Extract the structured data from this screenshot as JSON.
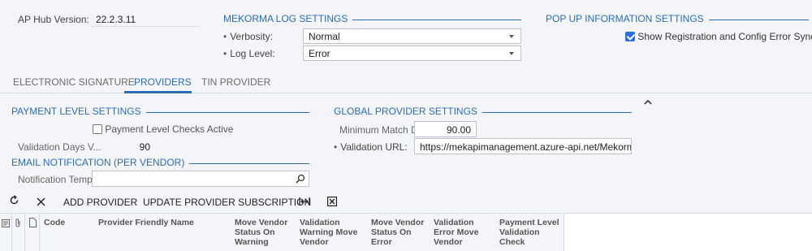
{
  "header": {
    "ap_hub_label": "AP Hub Version:",
    "ap_hub_value": "22.2.3.11"
  },
  "log_settings": {
    "title": "MEKORMA LOG SETTINGS",
    "verbosity_label": "Verbosity:",
    "verbosity_value": "Normal",
    "log_level_label": "Log Level:",
    "log_level_value": "Error"
  },
  "popup_settings": {
    "title": "POP UP INFORMATION SETTINGS",
    "show_errors_label": "Show Registration and Config Error Sync Notes",
    "show_errors_checked": true
  },
  "tabs": [
    {
      "label": "ELECTRONIC SIGNATURE"
    },
    {
      "label": "PROVIDERS"
    },
    {
      "label": "TIN PROVIDER"
    }
  ],
  "payment_level": {
    "title": "PAYMENT LEVEL SETTINGS",
    "checks_active_label": "Payment Level Checks Active",
    "validation_days_label": "Validation Days V...",
    "validation_days_value": "90"
  },
  "global_provider": {
    "title": "GLOBAL PROVIDER SETTINGS",
    "min_match_label": "Minimum Match D...",
    "min_match_value": "90.00",
    "validation_url_label": "Validation URL:",
    "validation_url_value": "https://mekapimanagement.azure-api.net/MekormaValidati"
  },
  "email_notification": {
    "title": "EMAIL NOTIFICATION (PER VENDOR)",
    "template_label": "Notification Templ...",
    "template_value": ""
  },
  "toolbar": {
    "refresh_icon": "refresh-icon",
    "close_icon": "close-icon",
    "add_provider": "ADD PROVIDER",
    "update_subscription": "UPDATE PROVIDER SUBSCRIPTION",
    "fit_icon": "fit-columns-icon",
    "excel_icon": "excel-export-icon"
  },
  "grid": {
    "columns": [
      "Code",
      "Provider Friendly Name",
      "Move Vendor Status On Warning",
      "Validation Warning Move Vendor",
      "Move Vendor Status On Error",
      "Validation Error Move Vendor",
      "Payment Level Validation Check"
    ]
  },
  "colors": {
    "accent": "#2b6db5",
    "background": "#f3f5f8"
  }
}
